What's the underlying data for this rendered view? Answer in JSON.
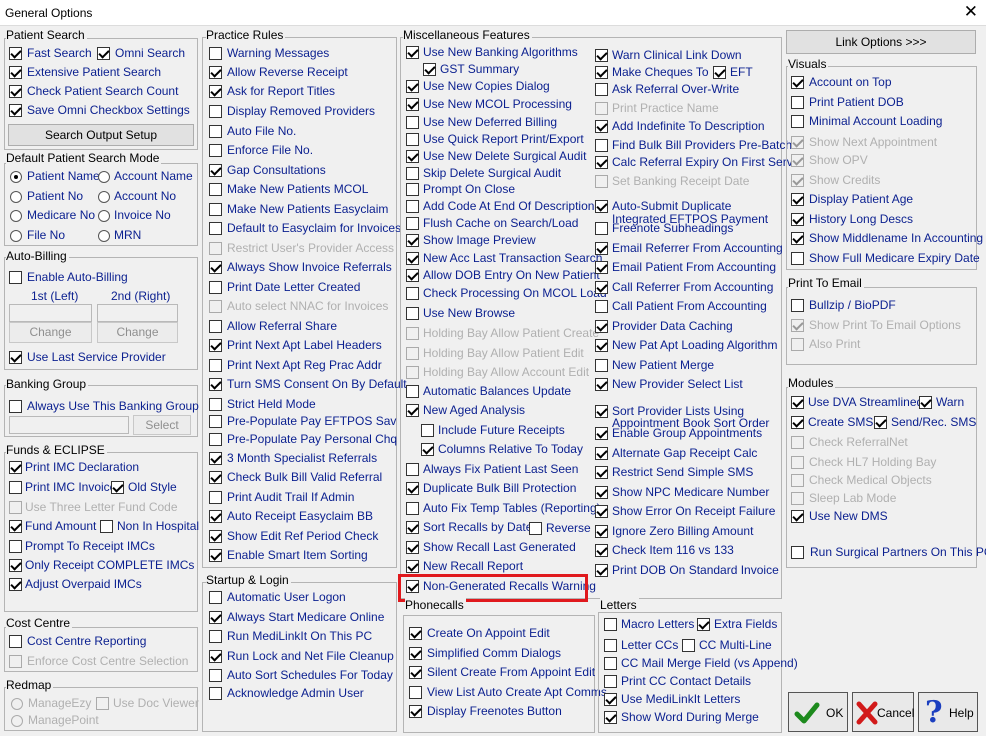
{
  "window": {
    "title": "General Options"
  },
  "patientSearch": {
    "title": "Patient Search",
    "fastSearch": "Fast Search",
    "omniSearch": "Omni Search",
    "extended": "Extensive Patient Search",
    "checkCount": "Check Patient Search Count",
    "saveOmni": "Save Omni Checkbox Settings",
    "outputSetup": "Search Output Setup"
  },
  "defaultMode": {
    "title": "Default Patient Search Mode",
    "patientName": "Patient Name",
    "accountName": "Account Name",
    "patientNo": "Patient No",
    "accountNo": "Account No",
    "medicareNo": "Medicare No",
    "invoiceNo": "Invoice No",
    "fileNo": "File No",
    "mrn": "MRN"
  },
  "autoBilling": {
    "title": "Auto-Billing",
    "enable": "Enable Auto-Billing",
    "first": "1st (Left)",
    "second": "2nd (Right)",
    "change": "Change",
    "useLast": "Use Last Service Provider"
  },
  "bankingGroup": {
    "title": "Banking Group",
    "always": "Always Use This Banking Group",
    "select": "Select"
  },
  "funds": {
    "title": "Funds & ECLIPSE",
    "printImc": "Print IMC Declaration",
    "imcInvoice": "Print IMC Invoice",
    "oldStyle": "Old Style",
    "threeLetter": "Use Three Letter Fund Code",
    "fundAmount": "Fund Amount",
    "nonHospital": "Non In Hospital",
    "prompt": "Prompt To Receipt IMCs",
    "onlyComplete": "Only Receipt COMPLETE IMCs",
    "adjust": "Adjust Overpaid IMCs"
  },
  "costCentre": {
    "title": "Cost Centre",
    "reporting": "Cost Centre Reporting",
    "enforce": "Enforce Cost Centre Selection"
  },
  "redmap": {
    "title": "Redmap",
    "manageEzy": "ManageEzy",
    "managePoint": "ManagePoint",
    "docViewer": "Use Doc Viewer"
  },
  "practiceRules": {
    "title": "Practice Rules",
    "items": [
      "Warning Messages",
      "Allow Reverse Receipt",
      "Ask for Report Titles",
      "Display Removed Providers",
      "Auto File No.",
      "Enforce File No.",
      "Gap Consultations",
      "Make New Patients MCOL",
      "Make New Patients Easyclaim",
      "Default to Easyclaim for Invoices",
      "Restrict User's Provider Access",
      "Always Show Invoice Referrals",
      "Print Date Letter Created",
      "Auto select NNAC for Invoices",
      "Allow Referral Share",
      "Print Next Apt Label Headers",
      "Print Next Apt Reg Prac Addr",
      "Turn SMS Consent On By Default",
      "Strict Held Mode",
      "Pre-Populate Pay EFTPOS Sav",
      "Pre-Populate Pay Personal Chq",
      "3 Month Specialist Referrals",
      "Check Bulk Bill Valid Referral",
      "Print Audit Trail If Admin",
      "Auto Receipt Easyclaim BB",
      "Show Edit Ref Period Check",
      "Enable Smart Item Sorting"
    ]
  },
  "startup": {
    "title": "Startup & Login",
    "items": [
      "Automatic User Logon",
      "Always Start Medicare Online",
      "Run MediLinkIt On This PC",
      "Run Lock and Net File Cleanup",
      "Auto Sort Schedules For Today",
      "Acknowledge Admin User"
    ]
  },
  "misc": {
    "title": "Miscellaneous Features",
    "col1": [
      "Use New Banking Algorithms",
      "GST Summary",
      "Use New Copies Dialog",
      "Use New MCOL Processing",
      "Use New Deferred Billing",
      "Use Quick Report Print/Export",
      "Use New Delete Surgical Audit",
      "Skip Delete Surgical Audit",
      "Prompt On Close",
      "Add Code At End Of Description",
      "Flush Cache on Search/Load",
      "Show Image Preview",
      "New Acc Last Transaction Search",
      "Allow DOB Entry On New Patient",
      "Check Processing On MCOL Load",
      "Use New Browse",
      "Holding Bay Allow Patient Create",
      "Holding Bay Allow Patient Edit",
      "Holding Bay Allow Account Edit",
      "Automatic Balances Update",
      "New Aged Analysis",
      "Include Future Receipts",
      "Columns Relative To Today",
      "Always Fix Patient Last Seen",
      "Duplicate Bulk Bill Protection",
      "Auto Fix Temp Tables (Reporting)",
      "Sort Recalls by Date",
      "Reverse",
      "Show Recall Last Generated",
      "New Recall Report",
      "Non-Generated Recalls Warning"
    ],
    "col2": [
      "Warn Clinical Link Down",
      "Make Cheques To",
      "EFT",
      "Ask Referral Over-Write",
      "Print Practice Name",
      "Add Indefinite To Description",
      "Find Bulk Bill Providers Pre-Batch",
      "Calc Referral Expiry On First Serv",
      "Set Banking Receipt Date",
      "Auto-Submit Duplicate",
      "Integrated EFTPOS Payment",
      "Freenote Subheadings",
      "Email Referrer From Accounting",
      "Email Patient From Accounting",
      "Call Referrer From Accounting",
      "Call Patient From Accounting",
      "Provider Data Caching",
      "New Pat Apt Loading Algorithm",
      "New Patient Merge",
      "New Provider Select List",
      "Sort Provider Lists Using",
      "Appointment Book Sort Order",
      "Enable Group Appointments",
      "Alternate Gap Receipt Calc",
      "Restrict Send Simple SMS",
      "Show NPC Medicare Number",
      "Show Error On Receipt Failure",
      "Ignore Zero Billing Amount",
      "Check Item 116 vs 133",
      "Print DOB On Standard Invoice"
    ]
  },
  "phonecalls": {
    "title": "Phonecalls",
    "items": [
      "Create On Appoint Edit",
      "Simplified Comm Dialogs",
      "Silent Create From Appoint Edit",
      "View List Auto Create Apt Comms",
      "Display Freenotes Button"
    ]
  },
  "letters": {
    "title": "Letters",
    "macro": "Macro Letters",
    "extra": "Extra Fields",
    "letterCcs": "Letter CCs",
    "ccMulti": "CC Multi-Line",
    "ccMerge": "CC Mail Merge Field (vs Append)",
    "printCc": "Print CC Contact Details",
    "useMedi": "Use MediLinkIt Letters",
    "showWord": "Show Word During Merge"
  },
  "linkOptions": "Link Options >>>",
  "visuals": {
    "title": "Visuals",
    "items": [
      "Account on Top",
      "Print Patient DOB",
      "Minimal Account Loading",
      "Show Next Appointment",
      "Show OPV",
      "Show Credits",
      "Display Patient Age",
      "History Long Descs",
      "Show Middlename In Accounting",
      "Show Full Medicare Expiry Date"
    ]
  },
  "printEmail": {
    "title": "Print To Email",
    "items": [
      "Bullzip / BioPDF",
      "Show Print To Email Options",
      "Also Print"
    ]
  },
  "modules": {
    "title": "Modules",
    "dva": "Use DVA Streamlined",
    "warn": "Warn",
    "createSms": "Create SMS",
    "sendRec": "Send/Rec. SMS",
    "items": [
      "Check ReferralNet",
      "Check HL7 Holding Bay",
      "Check Medical Objects",
      "Sleep Lab Mode",
      "Use New DMS"
    ],
    "surgical": "Run Surgical Partners On This PC"
  },
  "buttons": {
    "ok": "OK",
    "cancel": "Cancel",
    "help": "Help"
  }
}
